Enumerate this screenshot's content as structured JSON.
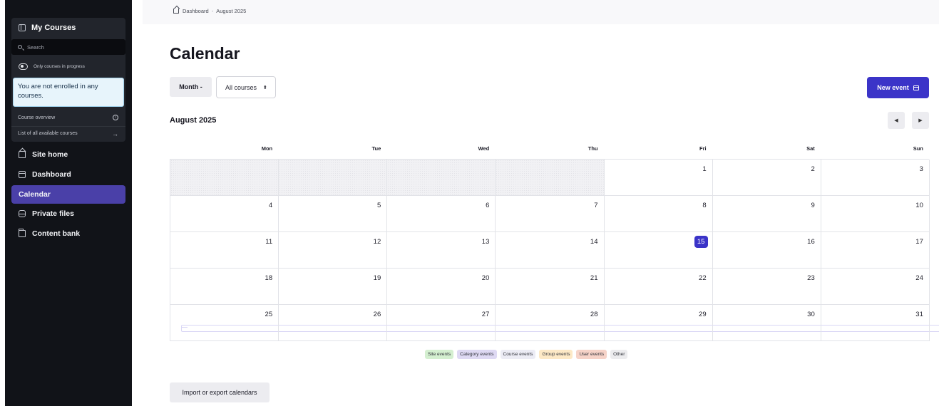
{
  "sidebar": {
    "courses_title": "My Courses",
    "search_placeholder": "Search",
    "toggle_label": "Only courses in progress",
    "alert": "You are not enrolled in any courses.",
    "course_overview": "Course overview",
    "all_courses": "List of all available courses",
    "nav": [
      {
        "label": "Site home",
        "icon": "home-icon"
      },
      {
        "label": "Dashboard",
        "icon": "dashboard-icon"
      },
      {
        "label": "Calendar",
        "icon": "calendar-icon",
        "active": true
      },
      {
        "label": "Private files",
        "icon": "drive-icon"
      },
      {
        "label": "Content bank",
        "icon": "folder-icon"
      }
    ]
  },
  "breadcrumb": {
    "home": "Dashboard",
    "separator": "-",
    "current": "August 2025"
  },
  "page_title": "Calendar",
  "controls": {
    "view": "Month -",
    "course_filter": "All courses",
    "new_event": "New event"
  },
  "month_label": "August 2025",
  "weekdays": [
    "Mon",
    "Tue",
    "Wed",
    "Thu",
    "Fri",
    "Sat",
    "Sun"
  ],
  "weeks": [
    [
      "",
      "",
      "",
      "",
      "1",
      "2",
      "3"
    ],
    [
      "4",
      "5",
      "6",
      "7",
      "8",
      "9",
      "10"
    ],
    [
      "11",
      "12",
      "13",
      "14",
      "15",
      "16",
      "17"
    ],
    [
      "18",
      "19",
      "20",
      "21",
      "22",
      "23",
      "24"
    ],
    [
      "25",
      "26",
      "27",
      "28",
      "29",
      "30",
      "31"
    ]
  ],
  "today": "15",
  "legend": [
    {
      "label": "Site events",
      "color": "#d4efd0"
    },
    {
      "label": "Category events",
      "color": "#ded9f3"
    },
    {
      "label": "Course events",
      "color": "#ececf5"
    },
    {
      "label": "Group events",
      "color": "#fde9c6"
    },
    {
      "label": "User events",
      "color": "#f6d3c8"
    },
    {
      "label": "Other",
      "color": "#ececee"
    }
  ],
  "import_export": "Import or export calendars",
  "colors": {
    "accent": "#3b34c8",
    "sidebar_active": "#4a40a8",
    "sidebar_bg": "#111318"
  }
}
